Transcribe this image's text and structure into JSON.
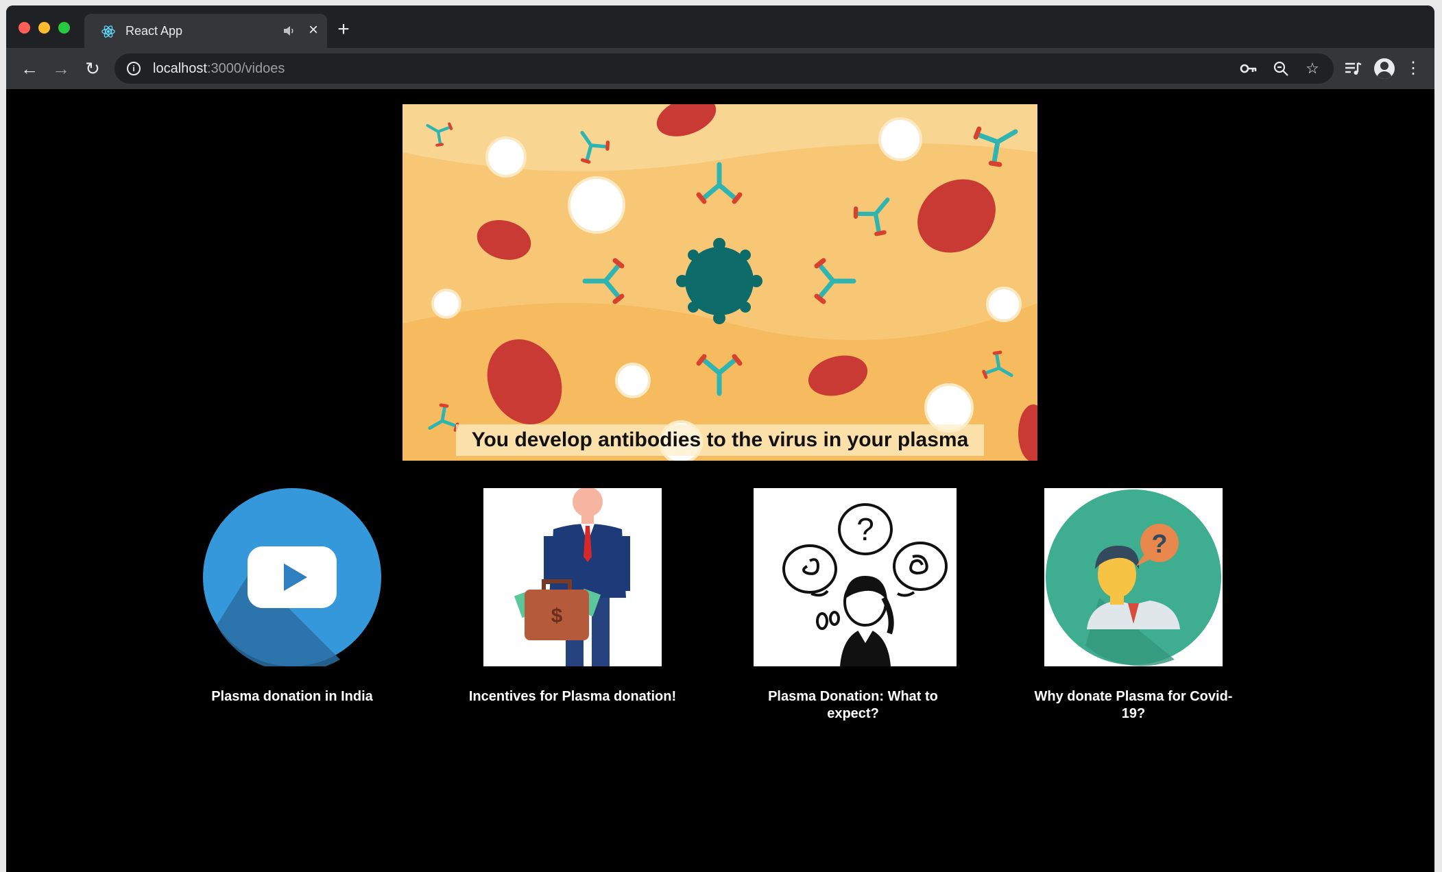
{
  "browser": {
    "tab_title": "React App",
    "url_host": "localhost",
    "url_rest": ":3000/vidoes",
    "icons": {
      "favicon": "react-atom-icon",
      "audio": "speaker-icon",
      "close": "close-icon",
      "new_tab": "plus-icon",
      "back": "arrow-left-icon",
      "forward": "arrow-right-icon",
      "reload": "reload-icon",
      "site_info": "info-icon",
      "passwords": "key-icon",
      "zoom": "zoom-icon",
      "bookmark": "star-icon",
      "media": "media-queue-icon",
      "profile": "profile-icon",
      "menu": "kebab-menu-icon"
    }
  },
  "video": {
    "caption": "You develop antibodies to the virus in your plasma"
  },
  "cards": [
    {
      "title": "Plasma donation in India",
      "thumbnail": "youtube-play-icon"
    },
    {
      "title": "Incentives for Plasma donation!",
      "thumbnail": "businessman-money-bag-illustration"
    },
    {
      "title": "Plasma Donation: What to expect?",
      "thumbnail": "woman-thinking-questions-illustration"
    },
    {
      "title": "Why donate Plasma for Covid-19?",
      "thumbnail": "man-question-bubble-icon"
    }
  ],
  "colors": {
    "tab_bar": "#202124",
    "toolbar": "#35363a",
    "page_background": "#000000",
    "youtube_blue": "#3498db",
    "teal_circle": "#3fad8f",
    "video_background": "#f7c776"
  }
}
